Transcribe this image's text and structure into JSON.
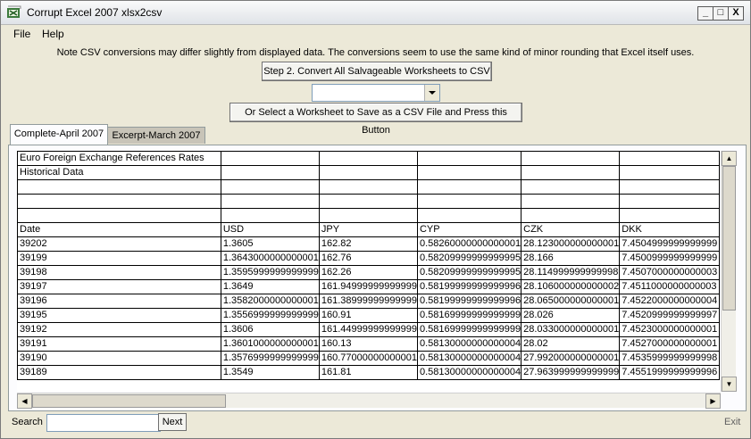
{
  "window": {
    "title": "Corrupt Excel 2007 xlsx2csv",
    "controls": {
      "minimize": "_",
      "maximize": "□",
      "close": "X"
    }
  },
  "menu": [
    "File",
    "Help"
  ],
  "note": "Note CSV conversions may differ slightly from displayed data. The conversions seem to use the same kind of minor rounding that Excel itself uses.",
  "buttons": {
    "convert_all": "Step 2. Convert All Salvageable Worksheets to CSV",
    "save_selected": "Or Select a Worksheet to Save as a CSV File and Press this Button"
  },
  "worksheet_dropdown": {
    "selected": ""
  },
  "tabs": [
    "Complete-April 2007",
    "Excerpt-March 2007"
  ],
  "grid": {
    "rows": [
      [
        "Euro Foreign Exchange References Rates",
        "",
        "",
        "",
        "",
        ""
      ],
      [
        "Historical Data",
        "",
        "",
        "",
        "",
        ""
      ],
      [
        "",
        "",
        "",
        "",
        "",
        ""
      ],
      [
        "",
        "",
        "",
        "",
        "",
        ""
      ],
      [
        "",
        "",
        "",
        "",
        "",
        ""
      ],
      [
        "Date",
        "USD",
        "JPY",
        "CYP",
        "CZK",
        "DKK"
      ],
      [
        "39202",
        "1.3605",
        "162.82",
        "0.58260000000000001",
        "28.123000000000001",
        "7.4504999999999999"
      ],
      [
        "39199",
        "1.3643000000000001",
        "162.76",
        "0.58209999999999995",
        "28.166",
        "7.4500999999999999"
      ],
      [
        "39198",
        "1.3595999999999999",
        "162.26",
        "0.58209999999999995",
        "28.114999999999998",
        "7.4507000000000003"
      ],
      [
        "39197",
        "1.3649",
        "161.94999999999999",
        "0.58199999999999996",
        "28.106000000000002",
        "7.4511000000000003"
      ],
      [
        "39196",
        "1.3582000000000001",
        "161.38999999999999",
        "0.58199999999999996",
        "28.065000000000001",
        "7.4522000000000004"
      ],
      [
        "39195",
        "1.3556999999999999",
        "160.91",
        "0.58169999999999999",
        "28.026",
        "7.4520999999999997"
      ],
      [
        "39192",
        "1.3606",
        "161.44999999999999",
        "0.58169999999999999",
        "28.033000000000001",
        "7.4523000000000001"
      ],
      [
        "39191",
        "1.3601000000000001",
        "160.13",
        "0.58130000000000004",
        "28.02",
        "7.4527000000000001"
      ],
      [
        "39190",
        "1.3576999999999999",
        "160.77000000000001",
        "0.58130000000000004",
        "27.992000000000001",
        "7.4535999999999998"
      ],
      [
        "39189",
        "1.3549",
        "161.81",
        "0.58130000000000004",
        "27.963999999999999",
        "7.4551999999999996"
      ]
    ]
  },
  "search": {
    "label": "Search",
    "value": "",
    "next_label": "Next"
  },
  "exit_label": "Exit"
}
